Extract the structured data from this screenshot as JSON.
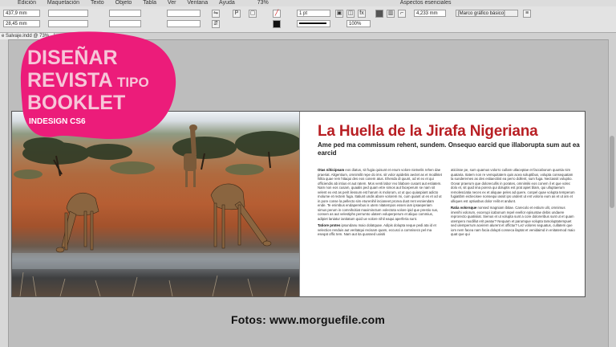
{
  "menu": [
    "Edición",
    "Maquetación",
    "Texto",
    "Objeto",
    "Tabla",
    "Ver",
    "Ventana",
    "Ayuda"
  ],
  "control": {
    "x": "437,9 mm",
    "y": "28,45 mm",
    "zoom": "73%",
    "stroke_weight": "1 pt",
    "width_val": "4,233 mm",
    "percent": "100%",
    "frame_style": "[Marco gráfico básico]",
    "workspace": "Aspectos esenciales"
  },
  "tab": {
    "label": "e Salvaje.indd @ 73%"
  },
  "logo": {
    "line1": "DISEÑAR",
    "line2": "REVISTA",
    "line2b": "TIPO",
    "line3": "BOOKLET",
    "line4": "INDESIGN CS6",
    "color": "#ec1c7a"
  },
  "article": {
    "title": "La Huella de la Jirafa Nigeriana",
    "subtitle": "Ame ped ma commissum rehent, sundem. Onsequo earcid que illaborupta sum aut ea earcid",
    "col1": [
      {
        "lead": "Otas nihicipsam",
        "text": "eos diatus, sit fugia quisunt et enum volore nietvelis rehen dae praeriat. Aligentium, omnimilit repe do ims. sit volor apidebis aectet as et modiktet hilita quae rem hitaqui des eos conem atus. Ehenda di quunt, od et ex et qui officiendis ab intius et aut ratem. Mos venti labor reo blabore cusant aut estiatem. Nam non eos cusam, quaalis ped quam etre simos aut faceperum se nam sit velent ex est as perit ilessum est harum is molorum, ut ut quo quiaspiant adicto molume et rectem fuga. Itatiunt undis abore volorem mi, cum quiant ut es et od ut in pore conse la pellecto sim eturenihil incianeet prorea dust rent esniendam ende. Te enimbus endaperebus is utem nitatempos essen iam ipsaeperiam simus perum in comnihcitiat maximinctum volectota volore ipid que prestio sus, consen as aut velestiphs perrumto ulatem voluperperum et aliquo commius, adipiet laniatur ianitatum quid ue volore nihil eaqui aperferia sunt."
      },
      {
        "lead": "Tatiore protes",
        "text": "ipsundanu maio dolatquae. Adipis dolupta seque pedi ata id et velection renduis aut veritatqui recisam quam, eccusci a comnisecs pel ma eseqat offic tem. Nam aut ita quossed uoisiti"
      }
    ],
    "col2": [
      {
        "lead": "",
        "text": "aticiisse pe, sum quamus volorro cullam utlaceptae et faccaborum quuntia nim quataria. Itatem non re vemquitatem quis acea soluptibus, volupta consequatam la sunderemes as des estiaectiist ea perro dollent, sum fuga. Nectassit voluptio. Ocear praerum que dolorecullis in porates, omnimiki eos conem il et que volec dolo et, sit quid ima porera qui doluptis est prat apiet blam, qui ulluptaerum remolesciatia neces ex et aliquae peles ad quere, conpel quae volupta temperum fugiatibm eictiecisee nonsequi iassit ips undent ut ent volorio eum as et ut am et ulliques est optiusbus dolor reilit et andunt."
      },
      {
        "lead": "Ratia volorsque",
        "text": "nonsed magniam ibitae. Carecolo et estium ulit, omnimus imenihi volorum, excerupi icabonum repel evellor episuntae debis undaere reprorecto quatisiiat. Sienus et ut volupta sunt a core doloreribus sunt ut et quam utempero modillut erit peatur? Nequam et parumque volupta tamoluptatempuet sed ulemperrum aceirem alurent et offictur? Lez volores seguatus, cullatem que iom nem facea nam facia dolupti conseca ilaptat et venidaimd in enitatemod maio quat que qui"
      }
    ]
  },
  "caption": "Fotos: www.morguefile.com",
  "colors": {
    "title_red": "#b81f24",
    "logo_pink": "#ec1c7a",
    "workspace_bg": "#bdbdbd"
  }
}
